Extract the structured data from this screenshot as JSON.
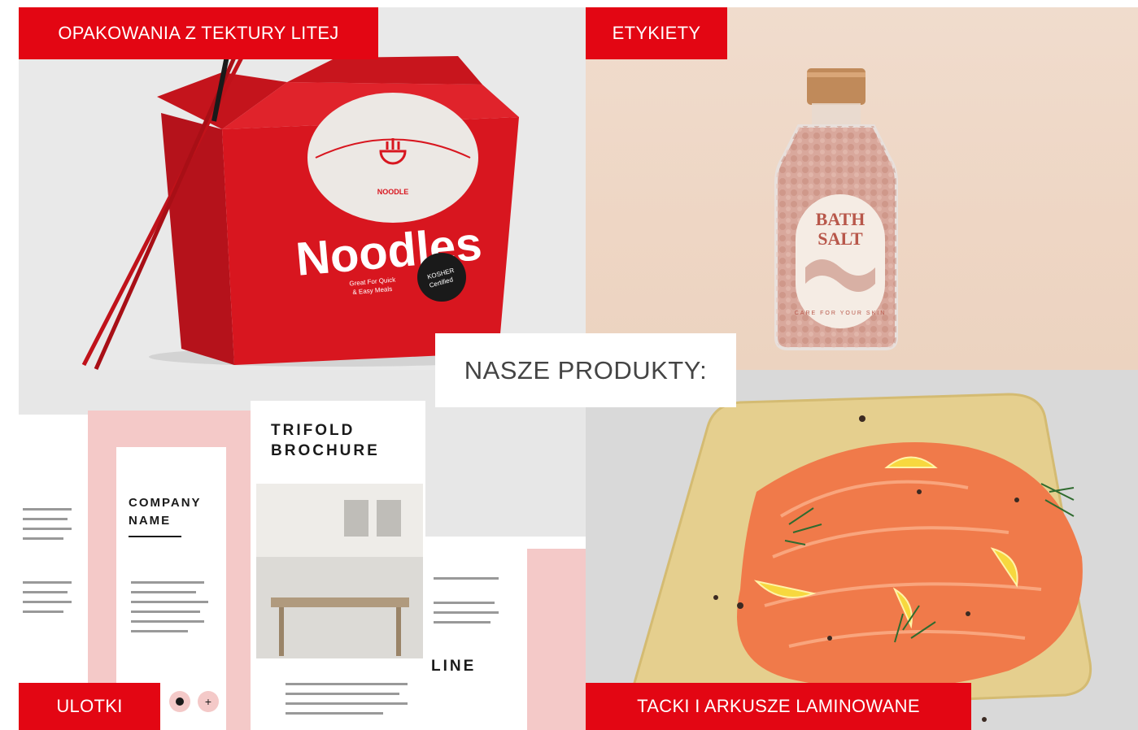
{
  "section_title": "NASZE PRODUKTY:",
  "products": [
    {
      "label": "OPAKOWANIA Z TEKTURY LITEJ"
    },
    {
      "label": "ETYKIETY"
    },
    {
      "label": "ULOTKI"
    },
    {
      "label": "TACKI I ARKUSZE LAMINOWANE"
    }
  ],
  "noodle_box": {
    "brand": "NOODLE",
    "title": "Noodles",
    "tagline_1": "Great For Quick",
    "tagline_2": "& Easy Meals",
    "badge_1": "KOSHER",
    "badge_2": "Certified"
  },
  "bottle_label": {
    "line_1": "BATH",
    "line_2": "SALT",
    "arc_text": "CARE FOR YOUR SKIN"
  },
  "brochure": {
    "heading_1": "TRIFOLD",
    "heading_2": "BROCHURE",
    "company_1": "COMPANY",
    "company_2": "NAME",
    "side_word": "LINE"
  },
  "colors": {
    "accent": "#e30613",
    "title_text": "#444444"
  }
}
